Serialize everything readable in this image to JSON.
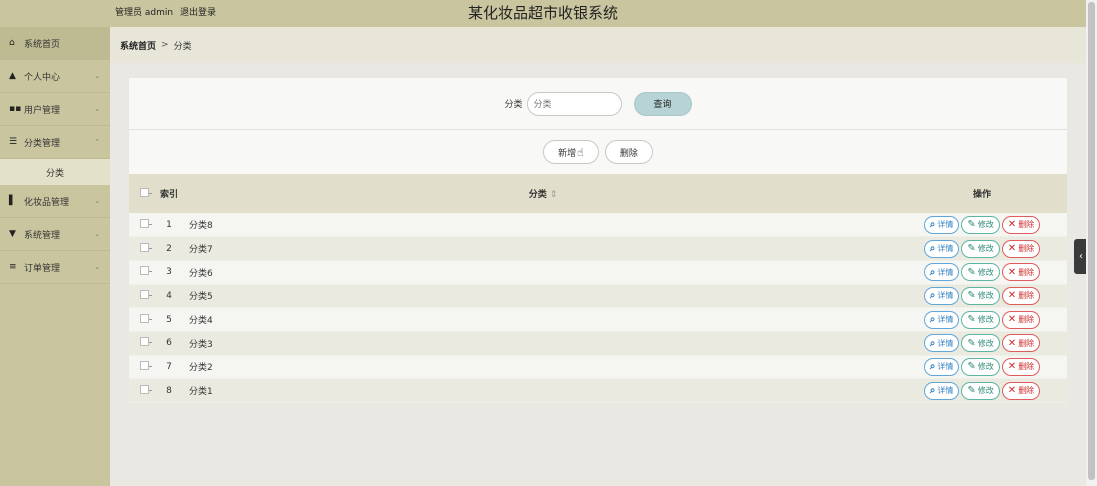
{
  "header": {
    "admin_label": "管理员 admin",
    "logout_label": "退出登录",
    "system_title": "某化妆品超市收银系统"
  },
  "sidebar": {
    "items": [
      {
        "icon": "home-icon",
        "glyph": "⌂",
        "label": "系统首页",
        "chevron": ""
      },
      {
        "icon": "person-icon",
        "glyph": "▲",
        "label": "个人中心",
        "chevron": "⌄"
      },
      {
        "icon": "grid-icon",
        "glyph": "▪▪",
        "label": "用户管理",
        "chevron": "⌄"
      },
      {
        "icon": "sliders-icon",
        "glyph": "☰",
        "label": "分类管理",
        "chevron": "⌃"
      },
      {
        "icon": "book-icon",
        "glyph": "▌",
        "label": "化妆品管理",
        "chevron": "⌄"
      },
      {
        "icon": "shield-icon",
        "glyph": "▼",
        "label": "系统管理",
        "chevron": "⌄"
      },
      {
        "icon": "list-icon",
        "glyph": "≡",
        "label": "订单管理",
        "chevron": "⌄"
      }
    ],
    "sub_item": "分类"
  },
  "breadcrumb": {
    "home": "系统首页",
    "separator": ">",
    "current": "分类"
  },
  "search": {
    "label": "分类",
    "placeholder": "分类",
    "button": "查询"
  },
  "actions": {
    "add": "新增",
    "delete": "删除"
  },
  "table": {
    "headers": {
      "index": "索引",
      "name": "分类",
      "sort": "⇕",
      "ops": "操作"
    },
    "rows": [
      {
        "index": "1",
        "name": "分类8"
      },
      {
        "index": "2",
        "name": "分类7"
      },
      {
        "index": "3",
        "name": "分类6"
      },
      {
        "index": "4",
        "name": "分类5"
      },
      {
        "index": "5",
        "name": "分类4"
      },
      {
        "index": "6",
        "name": "分类3"
      },
      {
        "index": "7",
        "name": "分类2"
      },
      {
        "index": "8",
        "name": "分类1"
      }
    ],
    "op_labels": {
      "detail": "详情",
      "edit": "修改",
      "delete": "删除"
    }
  },
  "colors": {
    "header_bg": "#c9c69f",
    "detail": "#2f7fc2",
    "edit": "#2e8a76",
    "delete": "#d12b2b"
  }
}
